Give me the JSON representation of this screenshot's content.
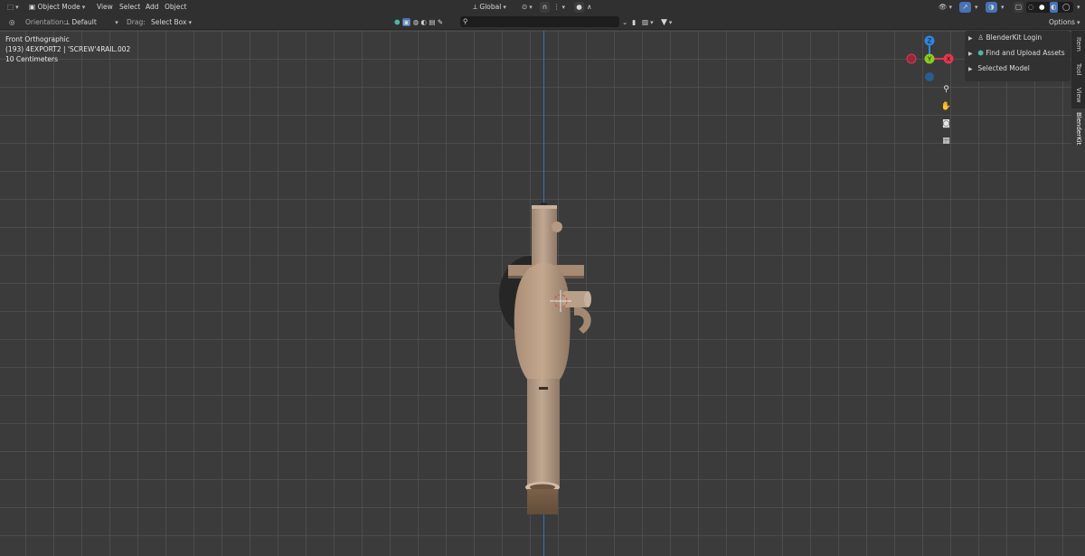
{
  "header": {
    "mode": "Object Mode",
    "menu": [
      "View",
      "Select",
      "Add",
      "Object"
    ],
    "transform_orientation": "Global",
    "shading_modes": [
      "wireframe-icon",
      "solid-icon",
      "material-preview-icon",
      "rendered-icon"
    ]
  },
  "toolheader": {
    "orientation_label": "Orientation:",
    "orientation_value": "Default",
    "drag_label": "Drag:",
    "drag_value": "Select Box",
    "search_placeholder": "",
    "options_label": "Options"
  },
  "viewport": {
    "view_name": "Front Orthographic",
    "object_info": "(193) 4EXPORT2 | 'SCREW'4RAIL.002",
    "grid_scale": "10 Centimeters"
  },
  "gizmo": {
    "z_label": "Z",
    "y_label": "Y",
    "x_label": "X"
  },
  "npanel": {
    "items": [
      "BlenderKit Login",
      "Find and Upload Assets",
      "Selected Model"
    ]
  },
  "tabs": [
    "Item",
    "Tool",
    "View",
    "BlenderKit"
  ],
  "colors": {
    "header_bg": "#303030",
    "viewport_bg": "#3b3b3b",
    "z_axis": "#3d6fb3",
    "axis_x": "#e3364f",
    "axis_y": "#8acc1d",
    "axis_z": "#2e86e0",
    "selected": "#4772b3",
    "model_tan": "#b59a81"
  }
}
